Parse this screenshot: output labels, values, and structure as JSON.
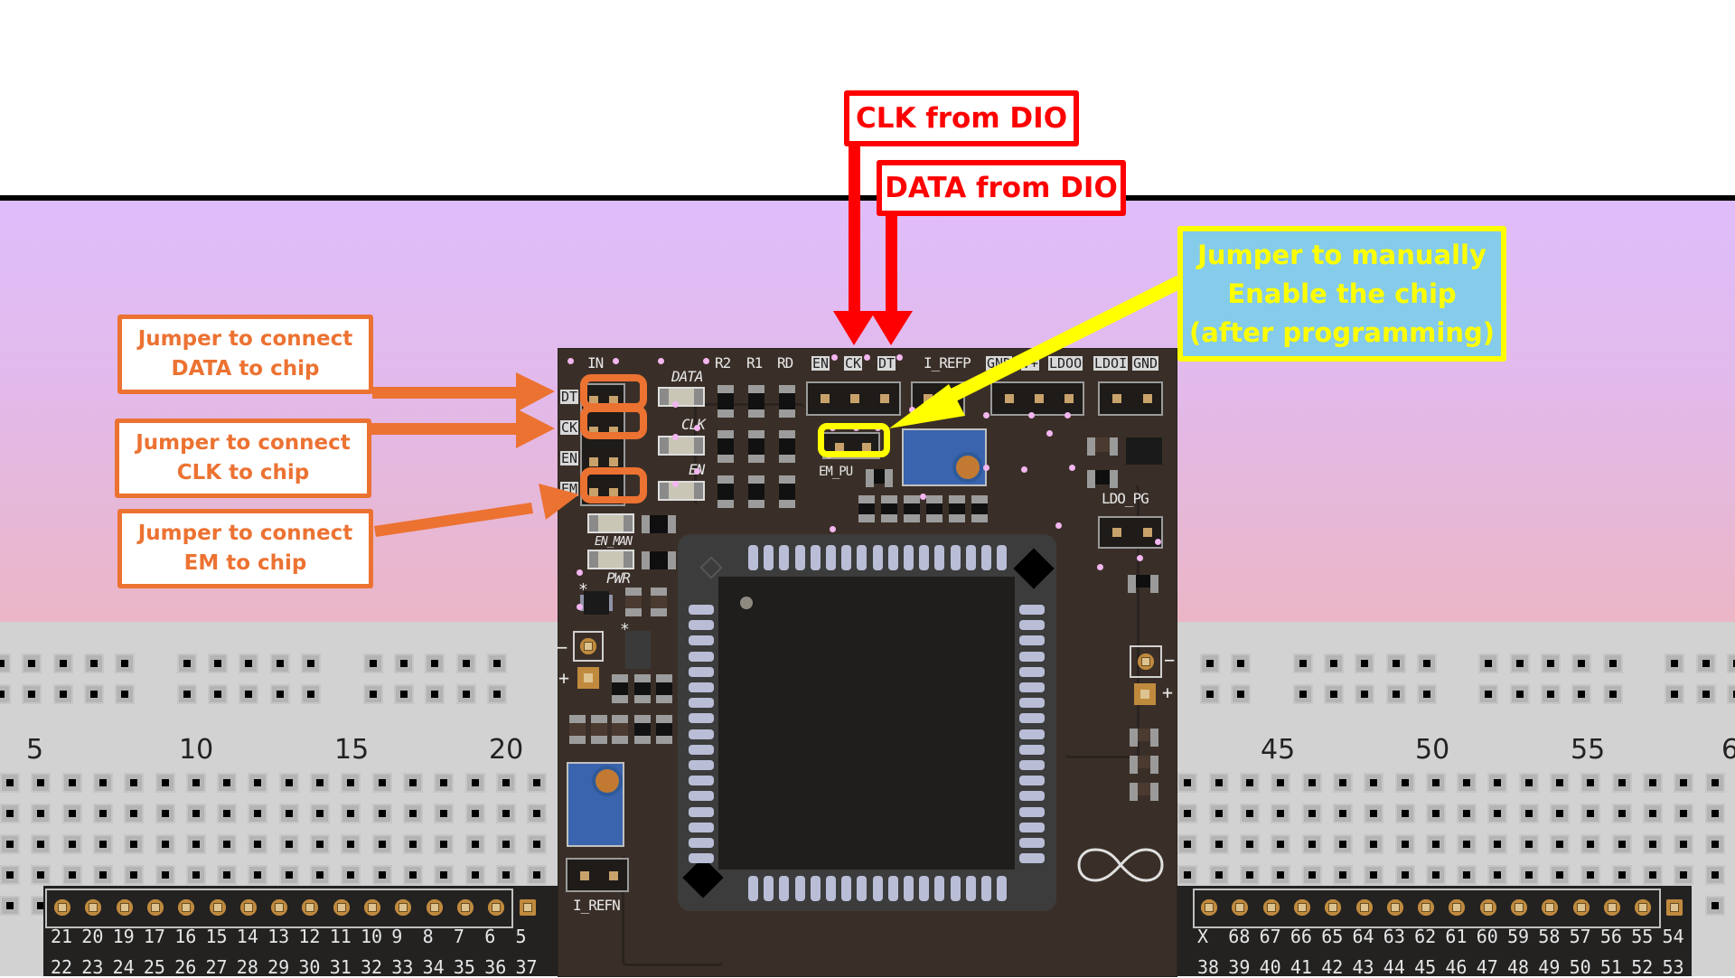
{
  "annotations": {
    "clk_from_dio": "CLK from DIO",
    "data_from_dio": "DATA from DIO",
    "enable_jumper": [
      "Jumper to manually",
      "Enable the chip",
      "(after programming)"
    ],
    "data_jumper": [
      "Jumper to connect",
      "DATA to chip"
    ],
    "clk_jumper": [
      "Jumper to connect",
      "CLK to chip"
    ],
    "em_jumper": [
      "Jumper to connect",
      "EM to chip"
    ]
  },
  "colors": {
    "red_callout": "#ff0000",
    "orange_callout": "#ec7232",
    "yellow_callout": "#ffff00",
    "callout_fill_blue": "#85cbea",
    "pcb": "#3a2f28"
  },
  "pcb_silkscreen": {
    "in": "IN",
    "left_pins": [
      "DT",
      "CK",
      "EN",
      "EM"
    ],
    "data": "DATA",
    "clk": "CLK",
    "en": "EN",
    "en_man": "EN_MAN",
    "pwr": "PWR",
    "r2": "R2",
    "r1": "R1",
    "rd": "RD",
    "top_pins": [
      "EN",
      "CK",
      "DT"
    ],
    "i_refp": "I_REFP",
    "power_pins": [
      "GND",
      "V+",
      "LDOO",
      "LDOI",
      "GND"
    ],
    "em_pu": "EM_PU",
    "ldo_pg": "LDO_PG",
    "i_refn": "I_REFN",
    "minus": "−",
    "plus": "+",
    "star": "*"
  },
  "breadboard": {
    "column_numbers_left": [
      "5",
      "10",
      "15",
      "20"
    ],
    "column_numbers_right": [
      "45",
      "50",
      "55",
      "6"
    ]
  },
  "headers": {
    "left_top": [
      "21",
      "20",
      "19",
      "17",
      "16",
      "15",
      "14",
      "13",
      "12",
      "11",
      "10",
      "9",
      "8",
      "7",
      "6",
      "5"
    ],
    "left_bottom": [
      "22",
      "23",
      "24",
      "25",
      "26",
      "27",
      "28",
      "29",
      "30",
      "31",
      "32",
      "33",
      "34",
      "35",
      "36",
      "37"
    ],
    "right_top": [
      "X",
      "68",
      "67",
      "66",
      "65",
      "64",
      "63",
      "62",
      "61",
      "60",
      "59",
      "58",
      "57",
      "56",
      "55",
      "54"
    ],
    "right_bottom": [
      "38",
      "39",
      "40",
      "41",
      "42",
      "43",
      "44",
      "45",
      "46",
      "47",
      "48",
      "49",
      "50",
      "51",
      "52",
      "53"
    ]
  },
  "chip": {
    "pads_per_side": 17
  }
}
